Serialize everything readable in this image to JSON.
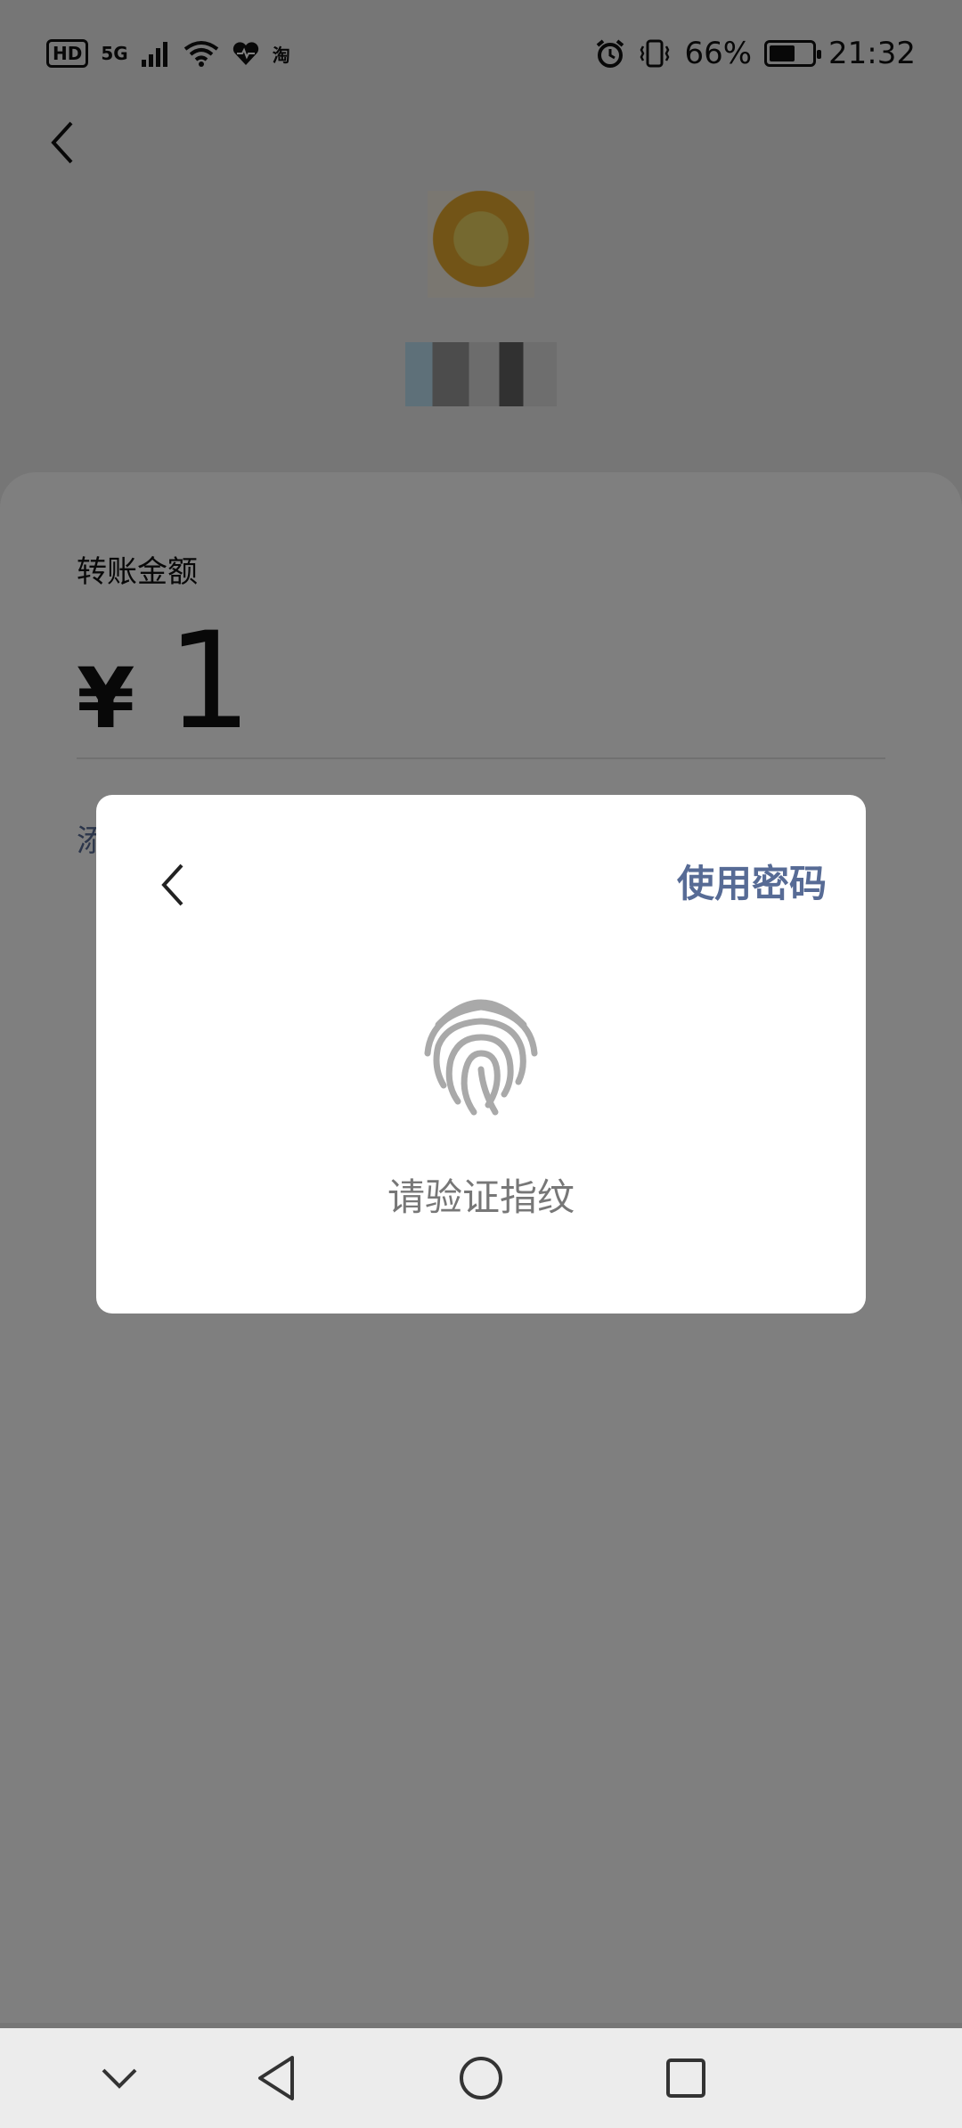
{
  "status_bar": {
    "hd_label": "HD",
    "network_label": "5G",
    "taobao_label": "淘",
    "battery_text": "66%",
    "battery_level": 0.66,
    "time": "21:32"
  },
  "header": {
    "back_icon": "chevron-left-icon"
  },
  "transfer": {
    "amount_label": "转账金额",
    "currency_symbol": "¥",
    "amount_value": "1",
    "remark_link_partial": "添"
  },
  "dialog": {
    "back_icon": "chevron-left-icon",
    "use_password_label": "使用密码",
    "fingerprint_icon": "fingerprint-icon",
    "verify_text": "请验证指纹"
  },
  "nav_bar": {
    "items": [
      "collapse-icon",
      "back-triangle-icon",
      "home-circle-icon",
      "recents-square-icon"
    ]
  },
  "colors": {
    "link_blue": "#576b95",
    "overlay": "rgba(0,0,0,0.5)"
  }
}
